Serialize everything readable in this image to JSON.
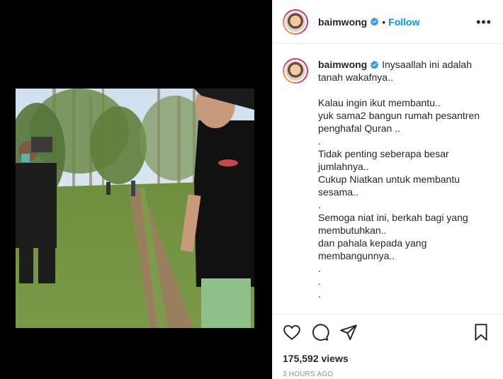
{
  "post": {
    "username": "baimwong",
    "verified": true,
    "follow_label": "Follow",
    "separator": "•",
    "more_label": "•••"
  },
  "caption": {
    "username": "baimwong",
    "lines": [
      "Inysaallah ini adalah tanah wakafnya..",
      "",
      "Kalau ingin ikut membantu..",
      "yuk sama2 bangun rumah pesantren penghafal Quran ..",
      ".",
      "Tidak penting seberapa besar jumlahnya..",
      "Cukup Niatkan untuk membantu sesama..",
      ".",
      "Semoga niat ini, berkah bagi yang membutuhkan..",
      "dan pahala kepada yang membangunnya..",
      ".",
      ".",
      "."
    ]
  },
  "stats": {
    "views": "175,592 views",
    "time": "3 HOURS AGO"
  },
  "icons": {
    "like": "heart-icon",
    "comment": "comment-icon",
    "share": "share-icon",
    "save": "bookmark-icon",
    "verified": "verified-badge-icon"
  },
  "colors": {
    "accent": "#0095f6",
    "verified": "#3897f0",
    "muted": "#8e8e8e"
  }
}
